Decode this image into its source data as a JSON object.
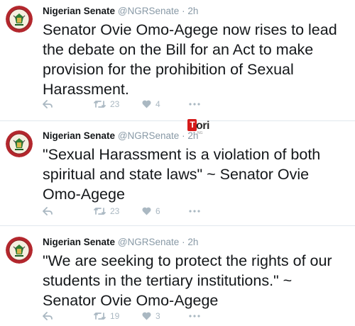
{
  "tweets": [
    {
      "name": "Nigerian Senate",
      "handle": "@NGRSenate",
      "dot": "·",
      "time": "2h",
      "text": "Senator Ovie Omo-Agege now rises to lead the debate on the Bill for an Act to make provision for the prohibition of Sexual Harassment.",
      "retweets": "23",
      "likes": "4"
    },
    {
      "name": "Nigerian Senate",
      "handle": "@NGRSenate",
      "dot": "·",
      "time": "2h",
      "text": "\"Sexual Harassment is a violation of both spiritual and state laws\" ~ Senator Ovie Omo-Agege",
      "retweets": "23",
      "likes": "6"
    },
    {
      "name": "Nigerian Senate",
      "handle": "@NGRSenate",
      "dot": "·",
      "time": "2h",
      "text": "\"We are seeking to protect the rights of our students in the tertiary institutions.\" ~ Senator Ovie Omo-Agege",
      "retweets": "19",
      "likes": "3"
    }
  ],
  "watermark": {
    "badge": "T",
    "word": "ori",
    "sub": "NG"
  },
  "colors": {
    "text": "#14171a",
    "muted": "#8899a6",
    "icon": "#aab8c2",
    "divider": "#e1e8ed",
    "avatar_ring": "#b3272d",
    "brand_red": "#d51a1a"
  }
}
